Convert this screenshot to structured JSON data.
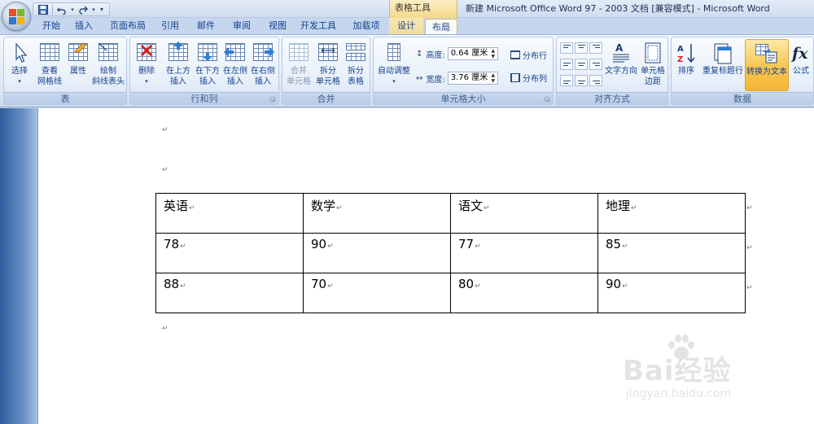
{
  "window": {
    "context_tool": "表格工具",
    "title": "新建 Microsoft Office Word 97 - 2003 文档 [兼容模式] - Microsoft Word"
  },
  "quick_access": {
    "save": "save-icon",
    "undo": "undo-icon",
    "redo": "redo-icon",
    "more": "▾"
  },
  "tabs": [
    {
      "label": "开始"
    },
    {
      "label": "插入"
    },
    {
      "label": "页面布局"
    },
    {
      "label": "引用"
    },
    {
      "label": "邮件"
    },
    {
      "label": "审阅"
    },
    {
      "label": "视图"
    },
    {
      "label": "开发工具"
    },
    {
      "label": "加载项"
    },
    {
      "label": "设计"
    },
    {
      "label": "布局"
    }
  ],
  "ribbon": {
    "table_group": {
      "label": "表",
      "select": "选择",
      "gridlines_1": "查看",
      "gridlines_2": "网格线",
      "properties": "属性",
      "diag_1": "绘制",
      "diag_2": "斜线表头"
    },
    "rows_group": {
      "label": "行和列",
      "delete": "删除",
      "above_1": "在上方",
      "above_2": "插入",
      "below_1": "在下方",
      "below_2": "插入",
      "left_1": "在左侧",
      "left_2": "插入",
      "right_1": "在右侧",
      "right_2": "插入"
    },
    "merge_group": {
      "label": "合并",
      "merge_1": "合并",
      "merge_2": "单元格",
      "split_1": "拆分",
      "split_2": "单元格",
      "splittable_1": "拆分",
      "splittable_2": "表格"
    },
    "cellsize_group": {
      "label": "单元格大小",
      "autofit": "自动调整",
      "height_label": "高度:",
      "height_value": "0.64 厘米",
      "width_label": "宽度:",
      "width_value": "3.76 厘米",
      "dist_rows": "分布行",
      "dist_cols": "分布列"
    },
    "align_group": {
      "label": "对齐方式",
      "text_dir": "文字方向",
      "margins_1": "单元格",
      "margins_2": "边距"
    },
    "data_group": {
      "label": "数据",
      "sort": "排序",
      "repeat_header": "重复标题行",
      "convert": "转换为文本",
      "formula": "公式"
    }
  },
  "document": {
    "para_mark": "↵",
    "table": {
      "headers": [
        "英语",
        "数学",
        "语文",
        "地理"
      ],
      "rows": [
        [
          "78",
          "90",
          "77",
          "85"
        ],
        [
          "88",
          "70",
          "80",
          "90"
        ]
      ]
    }
  },
  "watermark": {
    "text": "Bai经验",
    "sub": "jingyan.baidu.com"
  },
  "colors": {
    "ribbon_blue": "#dfe9f6",
    "tab_text": "#15428b",
    "context_yellow": "#f4d98a",
    "pressed_orange": "#f8c855"
  }
}
